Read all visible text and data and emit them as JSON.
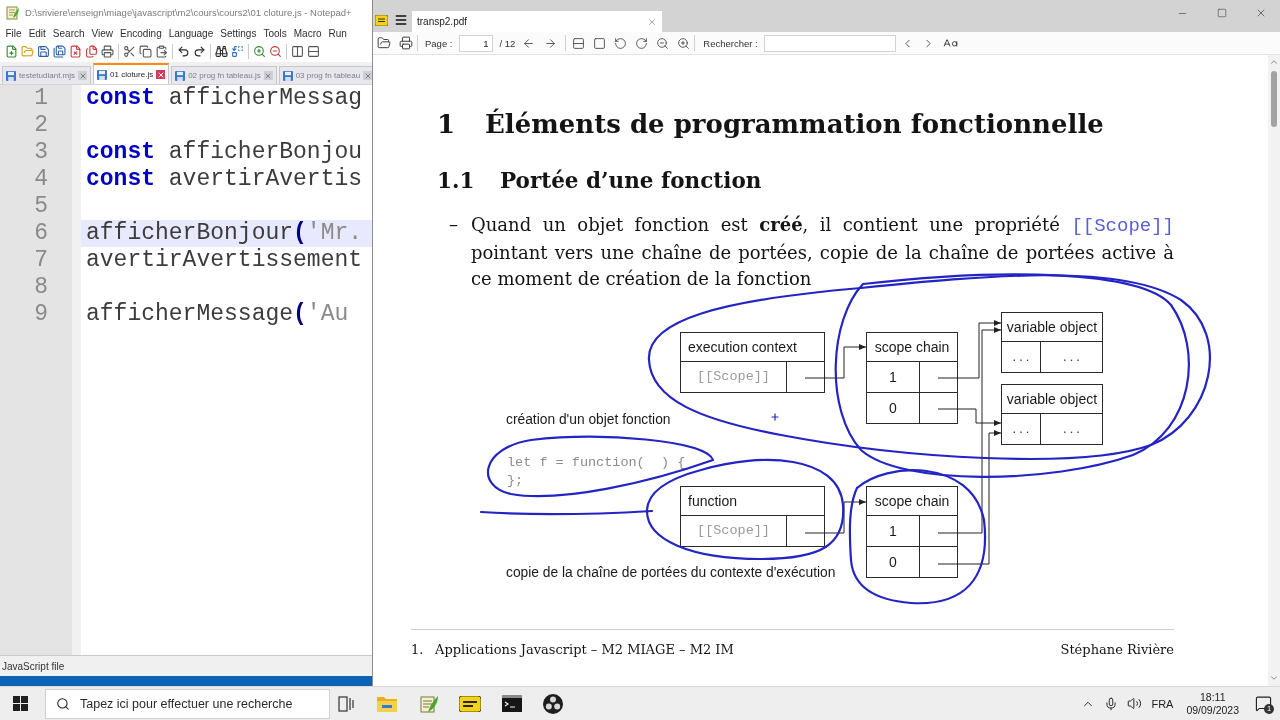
{
  "notepad": {
    "title": "D:\\sriviere\\enseign\\miage\\javascript\\m2\\cours\\cours2\\01 cloture.js - Notepad+",
    "menu": [
      "File",
      "Edit",
      "Search",
      "View",
      "Encoding",
      "Language",
      "Settings",
      "Tools",
      "Macro",
      "Run"
    ],
    "tabs": [
      {
        "label": "testetudiant.mjs",
        "selected": false
      },
      {
        "label": "01 cloture.js",
        "selected": true
      },
      {
        "label": "02 prog fn tableau.js",
        "selected": false
      },
      {
        "label": "03 prog fn tableau",
        "selected": false
      }
    ],
    "lines": [
      {
        "number": "1",
        "current": false,
        "tokens": [
          {
            "kind": "keyword",
            "text": "const"
          },
          {
            "kind": "plain",
            "text": " afficherMessag"
          }
        ]
      },
      {
        "number": "2",
        "current": false
      },
      {
        "number": "3",
        "current": false,
        "tokens": [
          {
            "kind": "keyword",
            "text": "const"
          },
          {
            "kind": "plain",
            "text": " afficherBonjou"
          }
        ]
      },
      {
        "number": "4",
        "current": false,
        "tokens": [
          {
            "kind": "keyword",
            "text": "const"
          },
          {
            "kind": "plain",
            "text": " avertirAvertis"
          }
        ]
      },
      {
        "number": "5",
        "current": false
      },
      {
        "number": "6",
        "current": true,
        "tokens": [
          {
            "kind": "plain",
            "text": "afficherBonjour"
          },
          {
            "kind": "paren",
            "text": "("
          },
          {
            "kind": "string",
            "text": "'Mr."
          }
        ]
      },
      {
        "number": "7",
        "current": false,
        "tokens": [
          {
            "kind": "plain",
            "text": "avertirAvertissement"
          }
        ]
      },
      {
        "number": "8",
        "current": false
      },
      {
        "number": "9",
        "current": false,
        "tokens": [
          {
            "kind": "plain",
            "text": "afficherMessage"
          },
          {
            "kind": "paren",
            "text": "("
          },
          {
            "kind": "string",
            "text": "'Au"
          }
        ]
      }
    ],
    "status": "JavaScript file"
  },
  "viewer": {
    "tab": {
      "label": "transp2.pdf"
    },
    "toolbar": {
      "page_label": "Page :",
      "page": "1",
      "page_total": "/ 12",
      "search_label": "Rechercher :"
    },
    "document": {
      "heading": {
        "number": "1",
        "title": "Éléments de programmation fonctionnelle"
      },
      "subheading": {
        "number": "1.1",
        "title": "Portée d’une fonction"
      },
      "bullet": {
        "marker": "–",
        "parts": [
          {
            "kind": "text",
            "text": "Quand un objet fonction est **créé**, il contient une propriété"
          },
          {
            "kind": "code",
            "text": "[[Scope]]"
          },
          {
            "kind": "text",
            "text": "pointant vers une chaîne de portées, copie de la chaîne de portées active à ce moment de création de la fonction"
          }
        ]
      },
      "diagram": {
        "labels": [
          "création d'un objet fonction",
          "copie de la chaîne de portées du contexte d'exécution"
        ],
        "code": [
          "let f = function(  ) {",
          "};"
        ],
        "nodes": [
          {
            "kind": "pointer",
            "title": "execution context",
            "field": "[[Scope]]"
          },
          {
            "kind": "chain",
            "title": "scope chain",
            "rows": [
              "1",
              "0"
            ]
          },
          {
            "kind": "object",
            "title": "variable object",
            "cells": [
              "...",
              "..."
            ]
          },
          {
            "kind": "object",
            "title": "variable object",
            "cells": [
              "...",
              "..."
            ]
          },
          {
            "kind": "pointer",
            "title": "function",
            "field": "[[Scope]]"
          },
          {
            "kind": "chain",
            "title": "scope chain",
            "rows": [
              "1",
              "0"
            ]
          }
        ]
      },
      "footer": {
        "number": "1.",
        "title": "Applications Javascript – M2 MIAGE – M2 IM",
        "author": "Stéphane Rivière"
      }
    }
  },
  "taskbar": {
    "search": {
      "placeholder": "Tapez ici pour effectuer une recherche"
    },
    "language": "FRA",
    "time": "18:11",
    "date": "09/09/2023",
    "notifications": "1"
  }
}
